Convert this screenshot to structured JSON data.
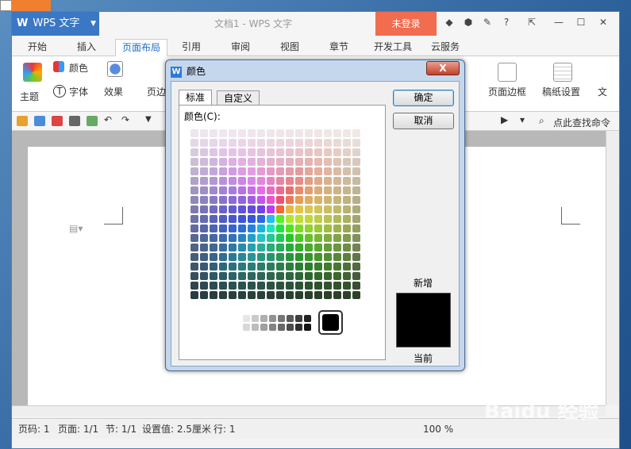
{
  "app": {
    "name": "WPS 文字",
    "doc_title": "文档1 - WPS 文字",
    "login": "未登录"
  },
  "tabs": [
    "开始",
    "插入",
    "页面布局",
    "引用",
    "审阅",
    "视图",
    "章节",
    "开发工具",
    "云服务"
  ],
  "active_tab": "页面布局",
  "ribbon": {
    "theme": "主题",
    "color": "颜色",
    "font": "字体",
    "effect": "效果",
    "margin": "页边",
    "border": "页面边框",
    "paper": "稿纸设置",
    "more": "文"
  },
  "quickbar": {
    "search": "点此查找命令"
  },
  "status": {
    "page_code": "页码: 1",
    "pages": "页面: 1/1",
    "section": "节: 1/1",
    "setting": "设置值: 2.5厘米",
    "row": "行: 1",
    "zoom": "100 %"
  },
  "dialog": {
    "title": "颜色",
    "close": "X",
    "tab_standard": "标准",
    "tab_custom": "自定义",
    "color_label": "颜色(C):",
    "ok": "确定",
    "cancel": "取消",
    "new": "新增",
    "current": "当前"
  },
  "watermark": "Baidu 经验"
}
